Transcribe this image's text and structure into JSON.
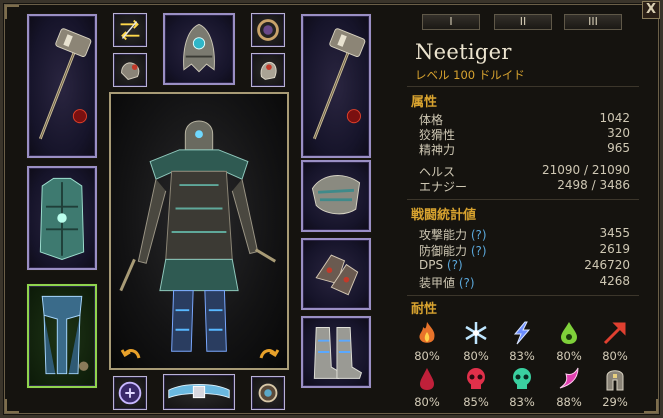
{
  "window": {
    "close_label": "X"
  },
  "tabs": [
    "I",
    "II",
    "III"
  ],
  "character": {
    "name": "Neetiger",
    "level_line": "レベル 100  ドルイド"
  },
  "attributes": {
    "title": "属性",
    "rows": [
      {
        "label": "体格",
        "value": "1042"
      },
      {
        "label": "狡猾性",
        "value": "320"
      },
      {
        "label": "精神力",
        "value": "965"
      },
      {
        "label": "ヘルス",
        "value": "21090 / 21090"
      },
      {
        "label": "エナジー",
        "value": "2498 / 3486"
      }
    ]
  },
  "combat": {
    "title": "戦闘統計値",
    "rows": [
      {
        "label": "攻撃能力",
        "help": "(?)",
        "value": "3455"
      },
      {
        "label": "防御能力",
        "help": "(?)",
        "value": "2619"
      },
      {
        "label": "DPS",
        "help": "(?)",
        "value": "246720"
      },
      {
        "label": "装甲値",
        "help": "(?)",
        "value": "4268"
      }
    ]
  },
  "resistances": {
    "title": "耐性",
    "items": [
      {
        "icon": "fire-icon",
        "value": "80%",
        "color": "#e8732a"
      },
      {
        "icon": "cold-icon",
        "value": "80%",
        "color": "#bfe6ff"
      },
      {
        "icon": "lightning-icon",
        "value": "83%",
        "color": "#6b8dff"
      },
      {
        "icon": "poison-icon",
        "value": "80%",
        "color": "#7fd13a"
      },
      {
        "icon": "pierce-icon",
        "value": "80%",
        "color": "#e04030"
      },
      {
        "icon": "bleeding-icon",
        "value": "80%",
        "color": "#c0203a"
      },
      {
        "icon": "vitality-icon",
        "value": "85%",
        "color": "#e0304a"
      },
      {
        "icon": "aether-icon",
        "value": "83%",
        "color": "#3ad0a0"
      },
      {
        "icon": "chaos-icon",
        "value": "88%",
        "color": "#e040b0"
      },
      {
        "icon": "stun-icon",
        "value": "29%",
        "color": "#b8b0a0"
      }
    ]
  },
  "equipment": [
    {
      "slot": "main-hand",
      "icon": "hammer-icon"
    },
    {
      "slot": "swap-weapons",
      "icon": "swap-arrows-icon"
    },
    {
      "slot": "head",
      "icon": "helmet-icon"
    },
    {
      "slot": "amulet",
      "icon": "amulet-icon"
    },
    {
      "slot": "off-hand",
      "icon": "hammer-icon"
    },
    {
      "slot": "ring-1",
      "icon": "gauntlet-icon"
    },
    {
      "slot": "ring-2",
      "icon": "gauntlet-icon"
    },
    {
      "slot": "chest",
      "icon": "chest-armor-icon"
    },
    {
      "slot": "shoulders",
      "icon": "shoulders-icon"
    },
    {
      "slot": "hands",
      "icon": "gloves-icon"
    },
    {
      "slot": "legs",
      "icon": "leg-armor-icon"
    },
    {
      "slot": "feet",
      "icon": "boots-icon"
    },
    {
      "slot": "medal",
      "icon": "medal-icon"
    },
    {
      "slot": "belt",
      "icon": "belt-icon"
    },
    {
      "slot": "relic",
      "icon": "relic-icon"
    }
  ]
}
